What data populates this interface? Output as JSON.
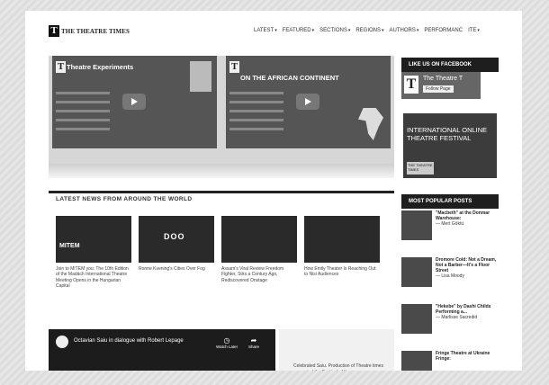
{
  "site": {
    "logo_letter": "T",
    "logo_text": "THE THEATRE TIMES"
  },
  "nav": [
    "LATEST",
    "FEATURED",
    "SECTIONS",
    "REGIONS",
    "AUTHORS",
    "PERFORMANC",
    "ITE"
  ],
  "hero": [
    {
      "title": "Theatre Experiments"
    },
    {
      "title": "ON THE AFRICAN CONTINENT"
    }
  ],
  "sidebar": {
    "facebook_heading": "LIKE US ON FACEBOOK",
    "fb_name": "The Theatre T",
    "fb_follow": "Follow Page",
    "promo_text": "INTERNATIONAL ONLINE THEATRE FESTIVAL",
    "promo_logo": "THE THEATRE TIMES",
    "popular_heading": "MOST POPULAR POSTS",
    "popular": [
      {
        "title": "\"Macbeth\" at the Donmar Warehouse:",
        "author": "— Mert Göktü"
      },
      {
        "title": "Dromore Cold: Not a Dream, Not a Barber—It's a Floor Street",
        "author": "— Lisa Moody"
      },
      {
        "title": "\"Hekebe\" by Dashi Childs Performing a...",
        "author": "— Marlisse Sacredid"
      },
      {
        "title": "Fringe Theatre at Ukraine Fringe:",
        "author": ""
      }
    ]
  },
  "latest": {
    "heading": "LATEST NEWS FROM AROUND THE WORLD",
    "items": [
      {
        "thumb_label": "MITEM",
        "caption": "Join to MITEM you: The 10th Edition of the Madách International Theatre Meeting Opens in the Hungarian Capital"
      },
      {
        "thumb_label": "DOO",
        "caption": "Ronne Kvening's Cities Over Fog"
      },
      {
        "thumb_label": "",
        "caption": "Assam's Viral Review Freedom Fighter, Stirs a Century Ago, Rediscovered Onstage"
      },
      {
        "thumb_label": "",
        "caption": "How Emily Theater Is Reaching Out to Nisi Audiences"
      }
    ]
  },
  "video": {
    "title": "Octavian Saiu in dialogue with Robert Lepage",
    "watch_later": "Watch Later",
    "share": "Share",
    "side_text": "Celebrated Saiu. Production of Theatre times presented the Festival of the"
  }
}
